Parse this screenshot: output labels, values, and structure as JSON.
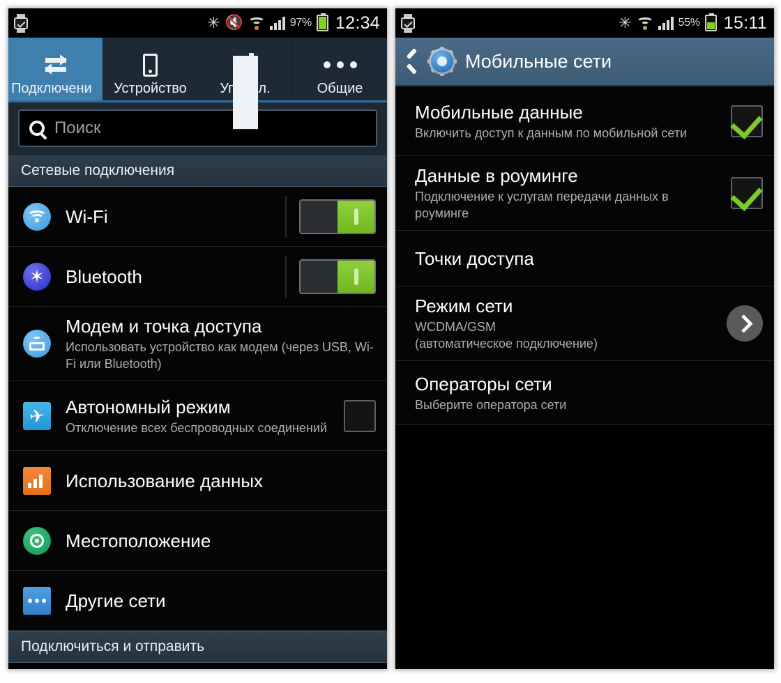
{
  "left_phone": {
    "status_bar": {
      "watch_icon": "smartwatch-icon",
      "icons": [
        "bluetooth-icon",
        "vibrate-mute-icon",
        "wifi-icon",
        "signal-bars-icon"
      ],
      "battery_percent": "97%",
      "clock": "12:34"
    },
    "tabs": [
      {
        "label": "Подключени",
        "icon": "swap-arrows-icon",
        "active": true
      },
      {
        "label": "Устройство",
        "icon": "phone-icon",
        "active": false
      },
      {
        "label": "Управл.",
        "icon": "sliders-icon",
        "active": false
      },
      {
        "label": "Общие",
        "icon": "ellipsis-icon",
        "active": false
      }
    ],
    "search": {
      "placeholder": "Поиск",
      "value": "",
      "icon": "search-icon"
    },
    "section_header": "Сетевые подключения",
    "items": [
      {
        "title": "Wi-Fi",
        "subtitle": "",
        "icon": "wifi-icon",
        "control": "toggle",
        "state": "on"
      },
      {
        "title": "Bluetooth",
        "subtitle": "",
        "icon": "bluetooth-icon",
        "control": "toggle",
        "state": "on"
      },
      {
        "title": "Модем и точка доступа",
        "subtitle": "Использовать устройство как модем (через USB, Wi-Fi или Bluetooth)",
        "icon": "tethering-icon",
        "control": "none",
        "state": ""
      },
      {
        "title": "Автономный режим",
        "subtitle": "Отключение всех беспроводных соединений",
        "icon": "airplane-icon",
        "control": "checkbox",
        "state": "off"
      },
      {
        "title": "Использование данных",
        "subtitle": "",
        "icon": "data-usage-icon",
        "control": "none",
        "state": ""
      },
      {
        "title": "Местоположение",
        "subtitle": "",
        "icon": "location-icon",
        "control": "none",
        "state": ""
      },
      {
        "title": "Другие сети",
        "subtitle": "",
        "icon": "other-networks-icon",
        "control": "none",
        "state": ""
      }
    ],
    "footer_section_header": "Подключиться и отправить"
  },
  "right_phone": {
    "status_bar": {
      "watch_icon": "smartwatch-icon",
      "icons": [
        "bluetooth-icon",
        "wifi-icon",
        "signal-bars-icon"
      ],
      "battery_percent": "55%",
      "clock": "15:11"
    },
    "action_bar": {
      "back_icon": "back-chevron-icon",
      "app_icon": "settings-gear-icon",
      "title": "Мобильные сети"
    },
    "items": [
      {
        "title": "Мобильные данные",
        "subtitle": "Включить доступ к данным по мобильной сети",
        "control": "checkbox",
        "state": "on"
      },
      {
        "title": "Данные в роуминге",
        "subtitle": "Подключение к услугам передачи данных в роуминге",
        "control": "checkbox",
        "state": "on"
      },
      {
        "title": "Точки доступа",
        "subtitle": "",
        "control": "none",
        "state": ""
      },
      {
        "title": "Режим сети",
        "subtitle": "WCDMA/GSM\n(автоматическое подключение)",
        "subtitle_line1": "WCDMA/GSM",
        "subtitle_line2": "(автоматическое подключение)",
        "control": "chevron",
        "state": ""
      },
      {
        "title": "Операторы сети",
        "subtitle": "Выберите оператора сети",
        "control": "none",
        "state": ""
      }
    ]
  },
  "colors": {
    "accent_blue": "#3f7fad",
    "toggle_green": "#7fc62d",
    "check_green": "#7cc928",
    "list_bg": "#050505",
    "header_bg": "#2f3e4b",
    "action_bar": "#4a6a86"
  }
}
